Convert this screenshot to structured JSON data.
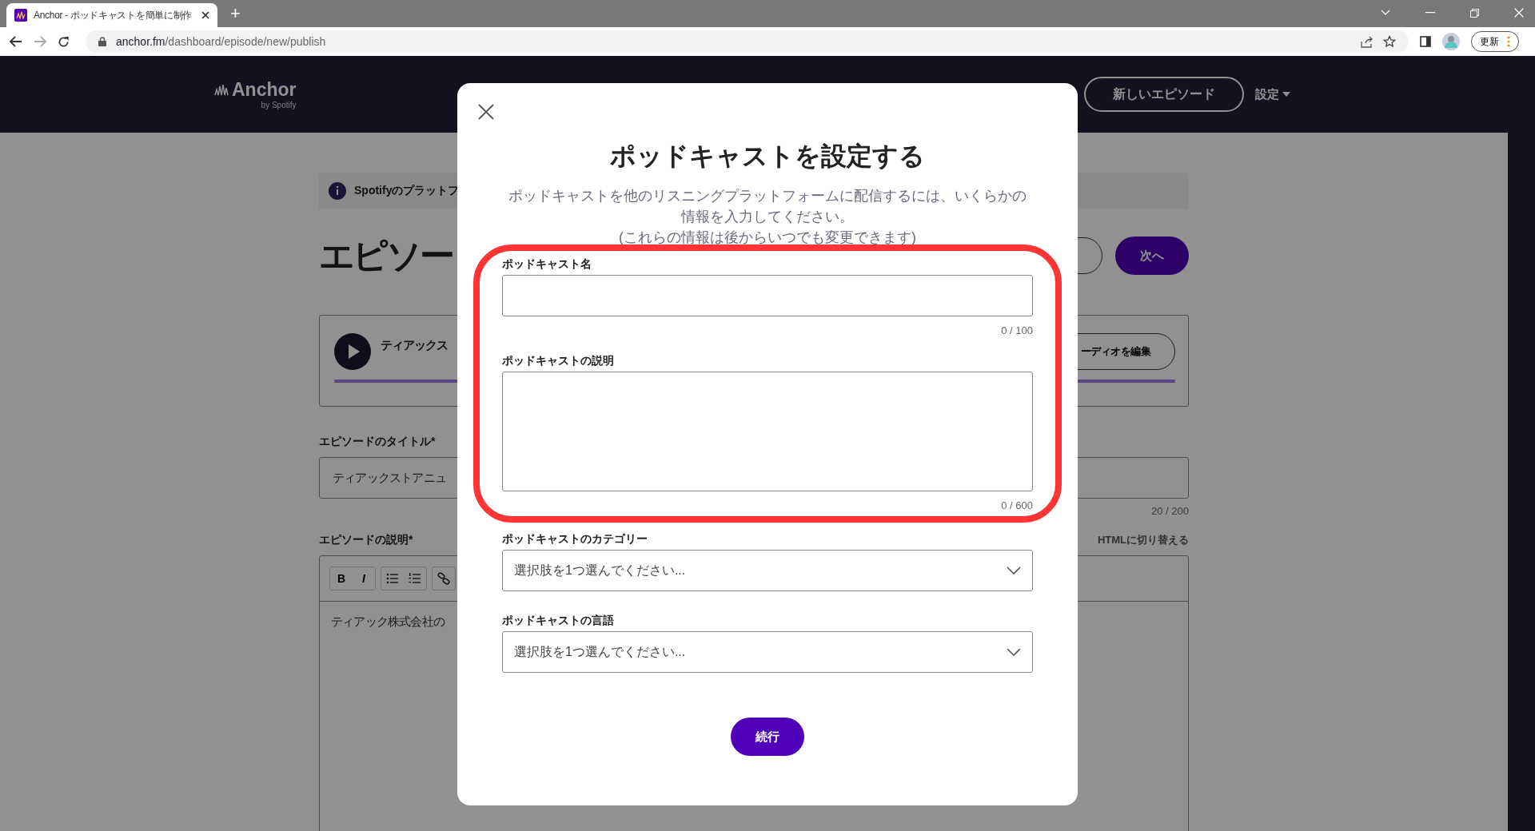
{
  "browser": {
    "tabs": [
      {
        "title": "Anchor - ポッドキャストを簡単に制作",
        "selected": true
      }
    ],
    "new_tab": "+",
    "url_host": "anchor.fm",
    "url_path": "/dashboard/episode/new/publish",
    "update_button": "更新"
  },
  "header": {
    "logo": "Anchor",
    "logo_sub": "by Spotify",
    "new_episode_button": "新しいエピソード",
    "settings_menu": "設定"
  },
  "page": {
    "banner": "Spotifyのプラットフ",
    "heading": "エピソー",
    "next_button": "次へ",
    "audio": {
      "title": "ティアックス",
      "edit_button": "ーディオを編集"
    },
    "title_field": {
      "label": "エピソードのタイトル*",
      "value": "ティアックストアニュ",
      "counter": "20 / 200"
    },
    "description_field": {
      "label": "エピソードの説明*",
      "switch_link": "HTMLに切り替える",
      "bold_button": "B",
      "italic_button": "I",
      "value": "ティアック株式会社の"
    }
  },
  "modal": {
    "title": "ポッドキャストを設定する",
    "description": "ポッドキャストを他のリスニングプラットフォームに配信するには、いくらかの情報を入力してください。",
    "note": "(これらの情報は後からいつでも変更できます)",
    "highlighted_fields": [
      {
        "kind": "text",
        "label": "ポッドキャスト名",
        "counter": "0 / 100"
      },
      {
        "kind": "textarea",
        "label": "ポッドキャストの説明",
        "counter": "0 / 600"
      }
    ],
    "fields": [
      {
        "kind": "select",
        "label": "ポッドキャストのカテゴリー",
        "placeholder": "選択肢を1つ選んでください..."
      },
      {
        "kind": "select",
        "label": "ポッドキャストの言語",
        "placeholder": "選択肢を1つ選んでください..."
      }
    ],
    "continue_button": "続行"
  }
}
